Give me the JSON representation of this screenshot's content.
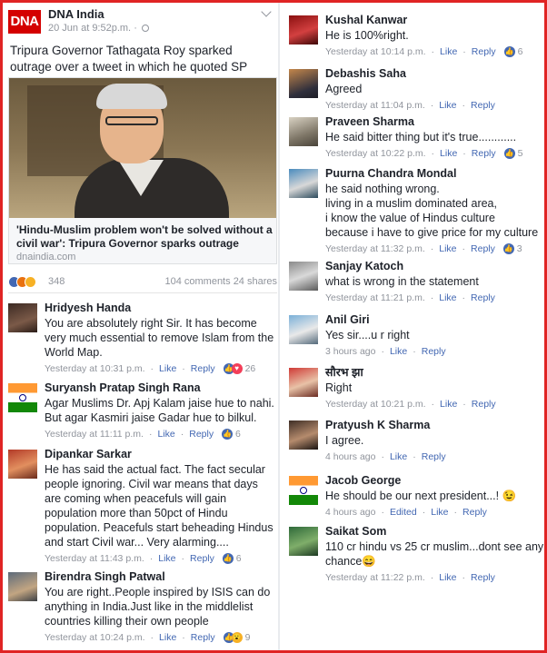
{
  "post": {
    "page_name": "DNA India",
    "logo_text": "DNA",
    "timestamp": "20 Jun at 9:52p.m.",
    "visibility_separator": "·",
    "text": "Tripura Governor Tathagata Roy sparked outrage over a tweet in which he quoted SP Mookerjee.",
    "link": {
      "title": "'Hindu-Muslim problem won't be solved without a civil war': Tripura Governor sparks outrage",
      "domain": "dnaindia.com"
    },
    "reaction_count": "348",
    "comments_count": "104 comments",
    "shares_count": "24 shares"
  },
  "actions": {
    "like": "Like",
    "reply": "Reply",
    "edited": "Edited"
  },
  "left_comments": [
    {
      "name": "Hridyesh Handa",
      "text": "You are absolutely right Sir. It has become very much essential to remove Islam from the World Map.",
      "time": "Yesterday at 10:31 p.m.",
      "reactions": "26"
    },
    {
      "name": "Suryansh Pratap Singh Rana",
      "text": "Agar Muslims Dr. Apj Kalam jaise hue to nahi. But agar Kasmiri jaise Gadar hue to bilkul.",
      "time": "Yesterday at 11:11 p.m.",
      "reactions": "6"
    },
    {
      "name": "Dipankar Sarkar",
      "text": "He has said the actual fact.  The fact secular people ignoring.  Civil war means that days are coming when peacefuls will gain population more than 50pct of Hindu population. Peacefuls start beheading Hindus and start Civil war...  Very alarming....",
      "time": "Yesterday at 11:43 p.m.",
      "reactions": "6"
    },
    {
      "name": "Birendra Singh Patwal",
      "text": "You are right..People inspired by ISIS  can do anything in India.Just like in the middlelist countries killing their own people",
      "time": "Yesterday at 10:24 p.m.",
      "reactions": "9"
    }
  ],
  "right_comments": [
    {
      "name": "Kushal Kanwar",
      "text": "He is 100%right.",
      "time": "Yesterday at 10:14 p.m.",
      "reactions": "6"
    },
    {
      "name": "Debashis Saha",
      "text": "Agreed",
      "time": "Yesterday at 11:04 p.m.",
      "reactions": ""
    },
    {
      "name": "Praveen Sharma",
      "text": "He said bitter thing but it's true............",
      "time": "Yesterday at 10:22 p.m.",
      "reactions": "5"
    },
    {
      "name": "Puurna Chandra Mondal",
      "text": "he said nothing wrong.\nliving in a muslim dominated area,\ni know the value of Hindus culture\nbecause i have  to give price for my culture",
      "time": "Yesterday at 11:32 p.m.",
      "reactions": "3"
    },
    {
      "name": "Sanjay Katoch",
      "text": "what is wrong in the statement",
      "time": "Yesterday at 11:21 p.m.",
      "reactions": ""
    },
    {
      "name": "Anil Giri",
      "text": "Yes sir....u r right",
      "time": "3 hours ago",
      "reactions": ""
    },
    {
      "name": "सौरभ झा",
      "text": "Right",
      "time": "Yesterday at 10:21 p.m.",
      "reactions": ""
    },
    {
      "name": "Pratyush K Sharma",
      "text": "I agree.",
      "time": "4 hours ago",
      "reactions": ""
    },
    {
      "name": "Jacob George",
      "text": "He should be our next president...! 😉",
      "time": "4 hours ago",
      "reactions": ""
    },
    {
      "name": "Saikat Som",
      "text": "110 cr hindu vs 25 cr muslim...dont see any chance😄",
      "time": "Yesterday at 11:22 p.m.",
      "reactions": ""
    }
  ],
  "colors": {
    "frame": "#e02424",
    "link": "#4267b2",
    "meta": "#90949c",
    "like": "#4267b2"
  }
}
